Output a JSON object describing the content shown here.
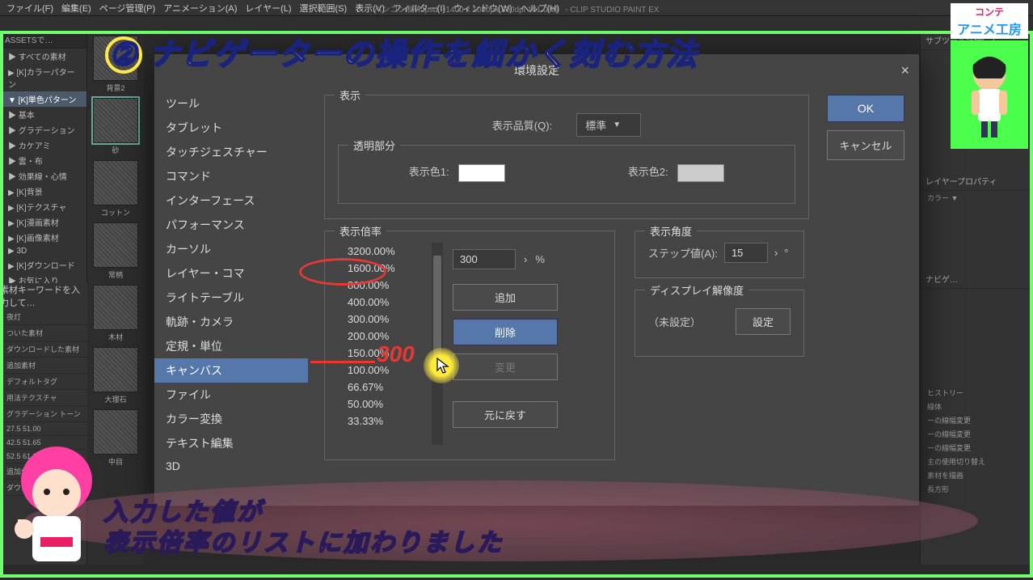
{
  "menubar": [
    "ファイル(F)",
    "編集(E)",
    "ページ管理(P)",
    "アニメーション(A)",
    "レイヤー(L)",
    "選択範囲(S)",
    "表示(V)",
    "フィルター(I)",
    "ウィンドウ(W)",
    "ヘルプ(H)"
  ],
  "window_title": "ハンコン制作.psd（1400 x 1080px 300dpi 101.0%） - CLIP STUDIO PAINT EX",
  "left_tree": {
    "header": "ASSETSで…",
    "items": [
      "▶ すべての素材",
      "▶ [K]カラーパターン",
      "▼ [K]単色パターン",
      "  ▶ 基本",
      "  ▶ グラデーション",
      "  ▶ カケアミ",
      "  ▶ 雲・布",
      "  ▶ 効果線・心情",
      "  ▶ [K]背景",
      "  ▶ [K]テクスチャ",
      "▶ [K]漫画素材",
      "▶ [K]画像素材",
      "▶ 3D",
      "▶ [K]ダウンロード",
      "▶ お気に入り"
    ],
    "selected_index": 2
  },
  "material_panel": {
    "header": "素材キーワードを入力して…",
    "rows": [
      "夜灯",
      "ついた素材",
      "ダウンロードした素材",
      "追加素材",
      "デフォルトタグ",
      "用法テクスチャ",
      "グラデーション  トーン",
      "27.5  51.00",
      "42.5  51.65",
      "52.5  61.00",
      "追加分(用)",
      "ダウ… アップ…"
    ]
  },
  "thumbs": [
    "背景2",
    "砂",
    "コットン",
    "常柄",
    "木材",
    "大理石",
    "中目"
  ],
  "right_panel": {
    "sections": [
      "サブツール詳細[…]",
      "レイヤープロパティ"
    ],
    "color_label": "カラー ▼",
    "nav_label": "ナビゲ…",
    "history_rows": [
      "ヒストリー",
      "線体",
      "ーの線幅変更",
      "ーの線幅変更",
      "ーの線幅変更",
      "主の使用切り替え",
      "素材を描画",
      "長方形"
    ]
  },
  "dialog": {
    "title": "環境設定",
    "close": "×",
    "categories": [
      "ツール",
      "タブレット",
      "タッチジェスチャー",
      "コマンド",
      "インターフェース",
      "パフォーマンス",
      "カーソル",
      "レイヤー・コマ",
      "ライトテーブル",
      "軌跡・カメラ",
      "定規・単位",
      "キャンバス",
      "ファイル",
      "カラー変換",
      "テキスト編集",
      "3D"
    ],
    "selected_category": 11,
    "display": {
      "group": "表示",
      "quality_label": "表示品質(Q):",
      "quality_value": "標準"
    },
    "transparent": {
      "group": "透明部分",
      "color1_label": "表示色1:",
      "color1": "#ffffff",
      "color2_label": "表示色2:",
      "color2": "#cccccc"
    },
    "zoom": {
      "group": "表示倍率",
      "levels": [
        "3200.00%",
        "1600.00%",
        "800.00%",
        "400.00%",
        "300.00%",
        "200.00%",
        "150.00%",
        "100.00%",
        "66.67%",
        "50.00%",
        "33.33%"
      ],
      "input_value": "300",
      "unit": "%",
      "buttons": {
        "add": "追加",
        "delete": "削除",
        "change": "変更",
        "reset": "元に戻す"
      }
    },
    "angle": {
      "group": "表示角度",
      "step_label": "ステップ値(A):",
      "step_value": "15",
      "unit": "°"
    },
    "resolution": {
      "group": "ディスプレイ解像度",
      "status": "（未設定）",
      "button": "設定"
    },
    "ok": "OK",
    "cancel": "キャンセル"
  },
  "overlay": {
    "badge_num": "②",
    "headline": "ナビゲーターの操作を細かく刻む方法",
    "red_value": "300",
    "caption_line1": "入力した値が",
    "caption_line2": "表示倍率のリストに加わりました",
    "logo_line1": "コンテ",
    "logo_line2": "アニメ工房"
  }
}
